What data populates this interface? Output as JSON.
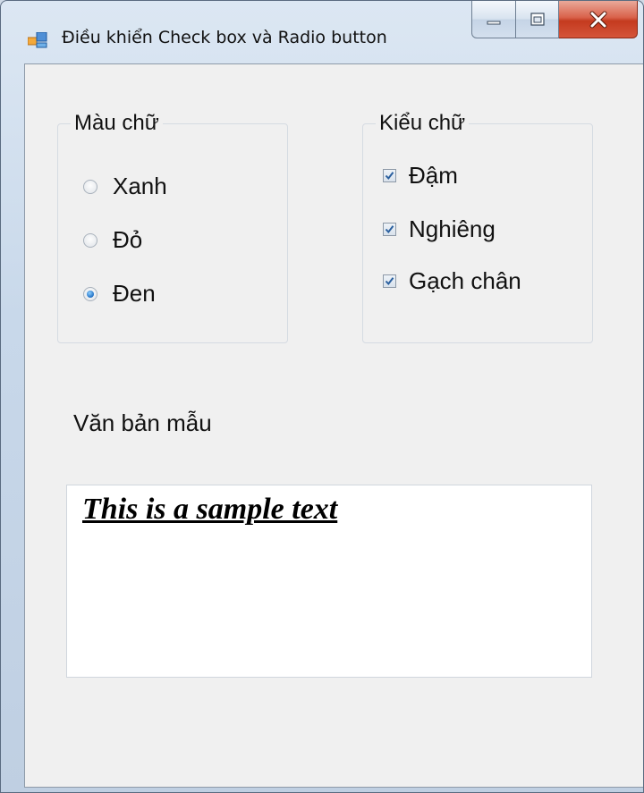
{
  "window": {
    "title": "Điều khiển Check box và Radio button",
    "controls": {
      "minimize_icon": "minimize-icon",
      "maximize_icon": "maximize-icon",
      "close_icon": "close-icon"
    }
  },
  "color_group": {
    "label": "Màu chữ",
    "options": [
      {
        "label": "Xanh",
        "selected": false
      },
      {
        "label": "Đỏ",
        "selected": false
      },
      {
        "label": "Đen",
        "selected": true
      }
    ]
  },
  "style_group": {
    "label": "Kiểu chữ",
    "options": [
      {
        "label": "Đậm",
        "checked": true
      },
      {
        "label": "Nghiêng",
        "checked": true
      },
      {
        "label": "Gạch chân",
        "checked": true
      }
    ]
  },
  "sample": {
    "caption": "Văn bản mẫu",
    "text": "This is a sample text"
  },
  "colors": {
    "close_button": "#c9442a",
    "client_background": "#f0f0f0",
    "radio_selected": "#1f6fc4",
    "check_mark": "#2a5f9e"
  }
}
